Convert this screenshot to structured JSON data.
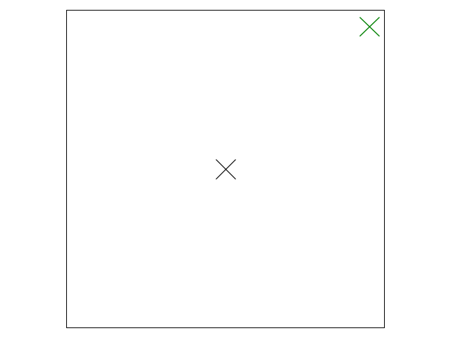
{
  "canvas": {
    "background": "#ffffff",
    "border_color": "#000000"
  },
  "markers": [
    {
      "name": "center-cross-icon",
      "color": "#000000"
    },
    {
      "name": "target-cross-icon",
      "color": "#008000"
    }
  ]
}
